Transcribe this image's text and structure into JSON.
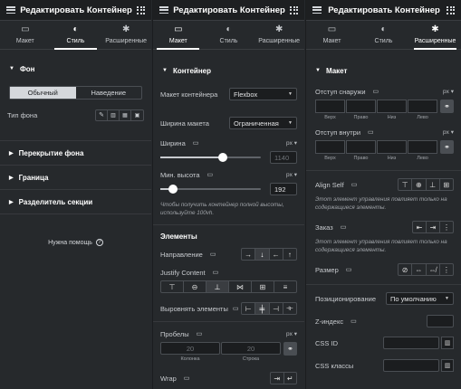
{
  "panel1": {
    "title": "Редактировать Контейнер",
    "tabs": [
      "Макет",
      "Стиль",
      "Расширенные"
    ],
    "bg_section": "Фон",
    "toggle": [
      "Обычный",
      "Наведение"
    ],
    "bg_type_label": "Тип фона",
    "sections": [
      "Перекрытие фона",
      "Граница",
      "Разделитель секции"
    ],
    "help": "Нужна помощь"
  },
  "panel2": {
    "title": "Редактировать Контейнер",
    "tabs": [
      "Макет",
      "Стиль",
      "Расширенные"
    ],
    "container_section": "Контейнер",
    "layout_label": "Макет контейнера",
    "layout_value": "Flexbox",
    "width_label": "Ширина макета",
    "width_value": "Ограниченная",
    "w_label": "Ширина",
    "w_unit": "px",
    "w_value": "1140",
    "w_slider": 0.62,
    "minh_label": "Мин. высота",
    "minh_unit": "px",
    "minh_value": "192",
    "minh_slider": 0.13,
    "hint": "Чтобы получить контейнер полной высоты, используйте 100vh.",
    "elements_section": "Элементы",
    "direction_label": "Направление",
    "justify_label": "Justify Content",
    "align_label": "Выровнять элементы",
    "gaps_label": "Пробелы",
    "gaps_unit": "px",
    "gap_col": "20",
    "gap_row": "20",
    "gap_col_label": "Колонка",
    "gap_row_label": "Строка",
    "wrap_label": "Wrap"
  },
  "panel3": {
    "title": "Редактировать Контейнер",
    "tabs": [
      "Макет",
      "Стиль",
      "Расширенные"
    ],
    "layout_section": "Макет",
    "margin_label": "Отступ снаружи",
    "padding_label": "Отступ внутри",
    "unit": "px",
    "sides": [
      "Верх",
      "Право",
      "Низ",
      "Лево"
    ],
    "align_self_label": "Align Self",
    "align_hint": "Этот элемент управления повлияет только на содержащиеся элементы.",
    "order_label": "Заказ",
    "order_hint": "Этот элемент управления повлияет только на содержащиеся элементы.",
    "size_label": "Размер",
    "position_label": "Позиционирование",
    "position_value": "По умолчанию",
    "zindex_label": "Z-индекс",
    "cssid_label": "CSS ID",
    "cssclass_label": "CSS классы"
  },
  "icons": {
    "menu": "hamburger-icon",
    "grid": "apps-grid-icon",
    "layout_tab": "columns-icon",
    "style_tab": "contrast-icon",
    "advanced_tab": "gear-icon",
    "monitor": "desktop-icon",
    "link": "link-icon",
    "help": "question-icon",
    "trash": "trash-icon"
  },
  "colors": {
    "panel_bg": "#26292c",
    "header_bg": "#1d1f21",
    "input_bg": "#1b1d1f",
    "border": "#4a4e53",
    "text": "#e0e1e3"
  }
}
